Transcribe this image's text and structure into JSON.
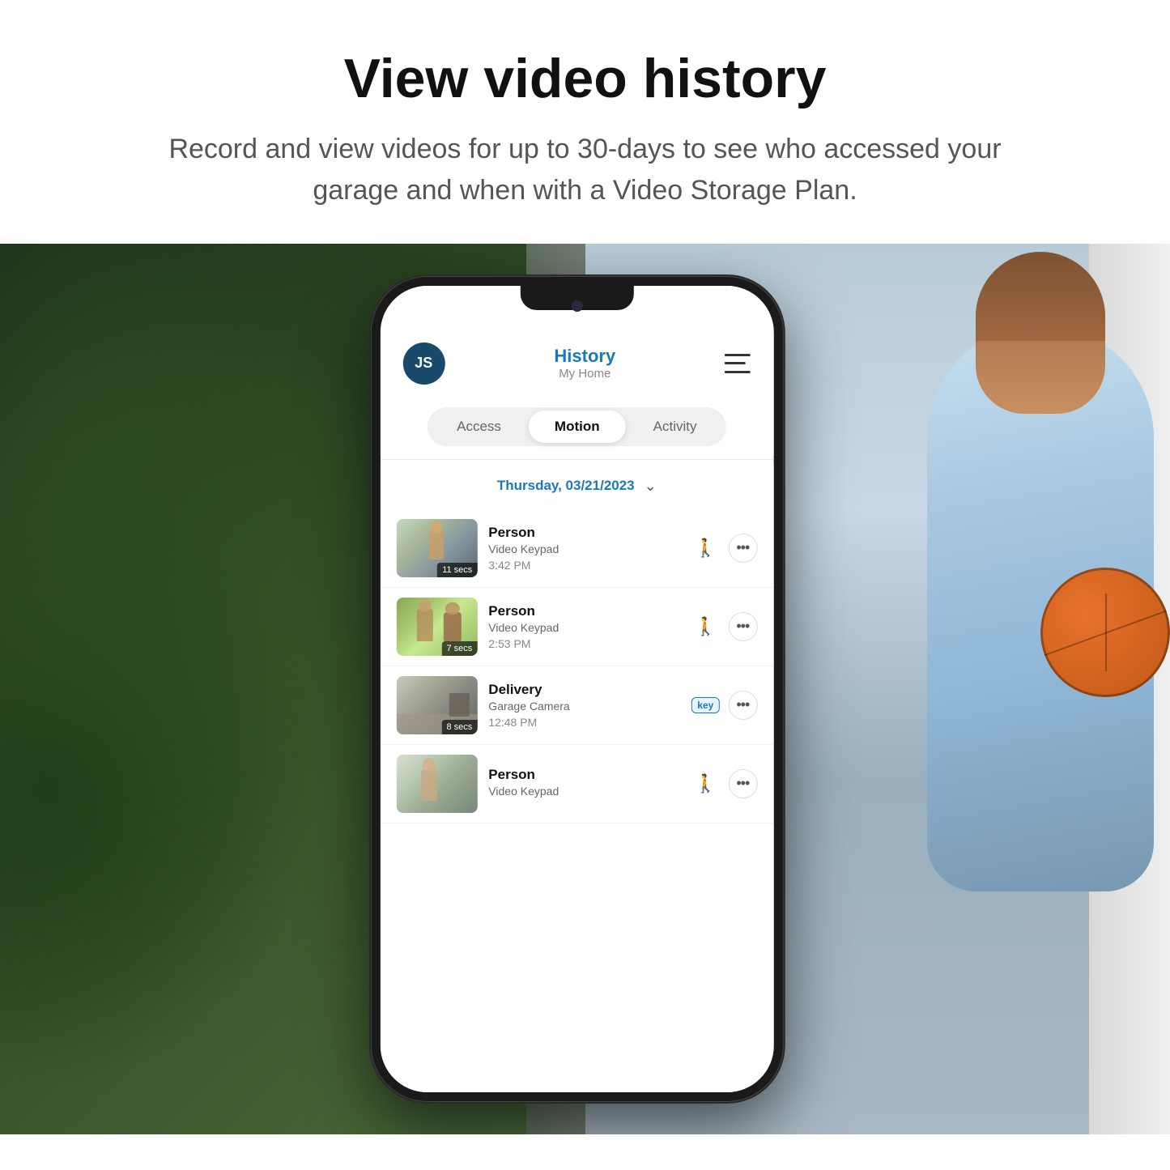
{
  "header": {
    "title": "View video history",
    "subtitle": "Record and view videos for up to 30-days to see who accessed your garage and when with a Video Storage Plan."
  },
  "app": {
    "avatar_initials": "JS",
    "screen_title": "History",
    "screen_subtitle": "My Home",
    "tabs": [
      {
        "label": "Access",
        "active": false
      },
      {
        "label": "Motion",
        "active": true
      },
      {
        "label": "Activity",
        "active": false
      }
    ],
    "date_header": "Thursday, 03/21/2023",
    "history_items": [
      {
        "title": "Person",
        "source": "Video Keypad",
        "time": "3:42 PM",
        "duration": "11 secs",
        "icon_type": "person"
      },
      {
        "title": "Person",
        "source": "Video Keypad",
        "time": "2:53 PM",
        "duration": "7 secs",
        "icon_type": "person"
      },
      {
        "title": "Delivery",
        "source": "Garage Camera",
        "time": "12:48 PM",
        "duration": "8 secs",
        "icon_type": "key"
      },
      {
        "title": "Person",
        "source": "Video Keypad",
        "time": "",
        "duration": "",
        "icon_type": "person"
      }
    ]
  }
}
